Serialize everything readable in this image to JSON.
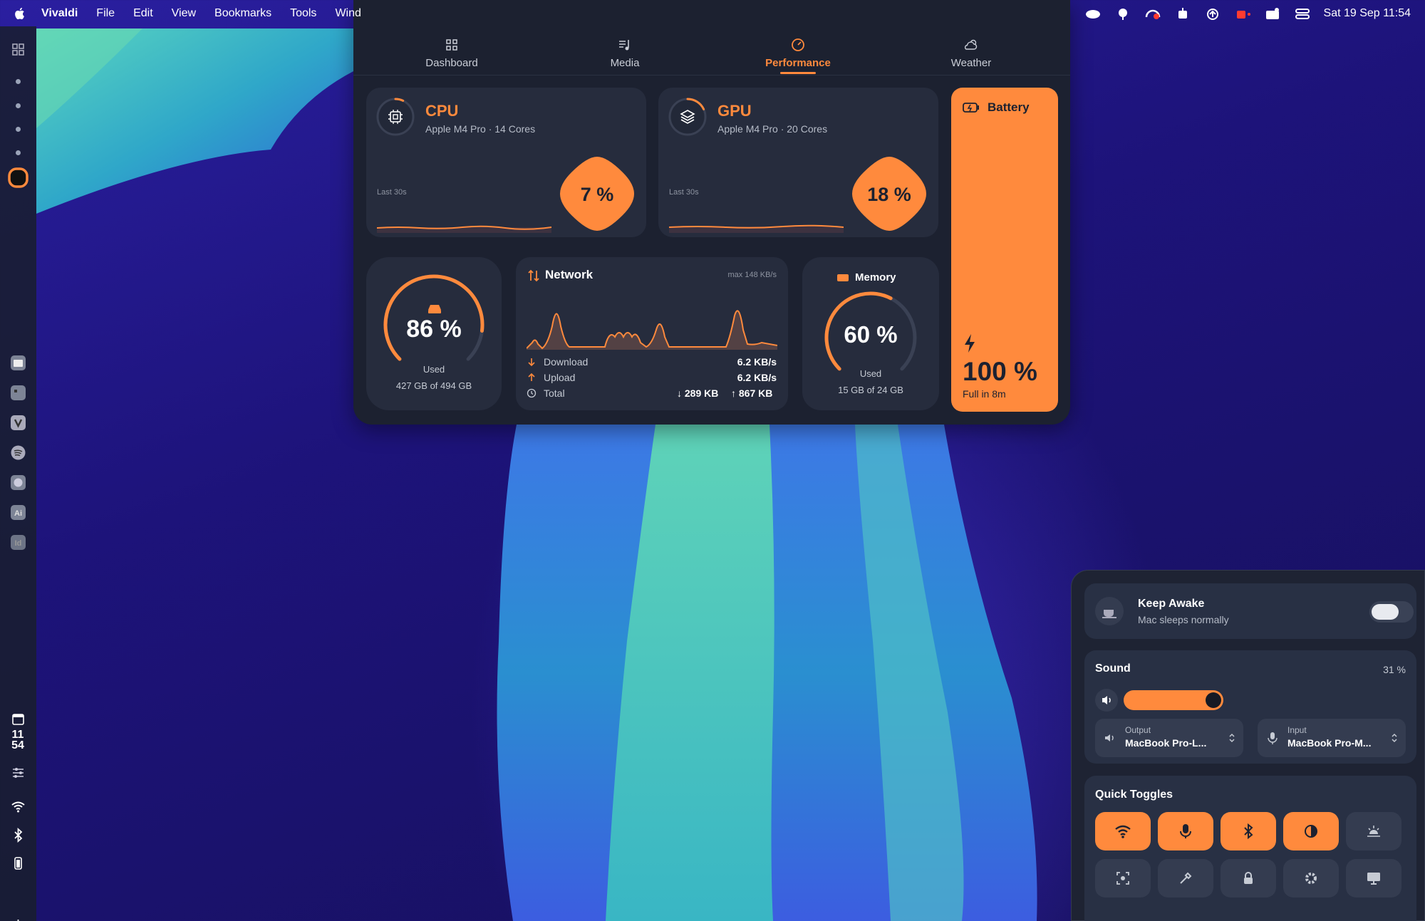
{
  "menubar": {
    "app_name": "Vivaldi",
    "menus": [
      "File",
      "Edit",
      "View",
      "Bookmarks",
      "Tools",
      "Wind"
    ],
    "clock": "Sat 19 Sep  11:54"
  },
  "sidebar": {
    "clock_hour": "11",
    "clock_min": "54"
  },
  "tabs": [
    {
      "label": "Dashboard",
      "icon": "grid-icon"
    },
    {
      "label": "Media",
      "icon": "music-icon"
    },
    {
      "label": "Performance",
      "icon": "gauge-icon",
      "active": true
    },
    {
      "label": "Weather",
      "icon": "cloud-sun-icon"
    }
  ],
  "cpu": {
    "title": "CPU",
    "subtitle": "Apple M4 Pro · 14 Cores",
    "history_label": "Last 30s",
    "percent": "7 %",
    "usage": 0.07
  },
  "gpu": {
    "title": "GPU",
    "subtitle": "Apple M4 Pro · 20 Cores",
    "history_label": "Last 30s",
    "percent": "18 %",
    "usage": 0.18
  },
  "battery": {
    "title": "Battery",
    "percent": "100 %",
    "status": "Full in 8m",
    "level": 1.0
  },
  "disk": {
    "percent": "86 %",
    "label": "Used",
    "detail": "427 GB of 494 GB",
    "usage": 0.86
  },
  "network": {
    "title": "Network",
    "max": "max 148 KB/s",
    "download_label": "Download",
    "download_value": "6.2 KB/s",
    "upload_label": "Upload",
    "upload_value": "6.2 KB/s",
    "total_label": "Total",
    "total_down": "↓ 289 KB",
    "total_up": "↑ 867 KB"
  },
  "memory": {
    "title": "Memory",
    "percent": "60 %",
    "label": "Used",
    "detail": "15 GB of 24 GB",
    "usage": 0.6
  },
  "control_center": {
    "keep_awake": {
      "title": "Keep Awake",
      "subtitle": "Mac sleeps normally",
      "enabled": false
    },
    "sound": {
      "title": "Sound",
      "percent": "31 %",
      "level": 0.31
    },
    "output": {
      "label": "Output",
      "value": "MacBook Pro-L..."
    },
    "input": {
      "label": "Input",
      "value": "MacBook Pro-M..."
    },
    "quick_toggles": {
      "title": "Quick Toggles",
      "row1": [
        {
          "icon": "wifi-icon",
          "on": true
        },
        {
          "icon": "microphone-icon",
          "on": true
        },
        {
          "icon": "bluetooth-icon",
          "on": true
        },
        {
          "icon": "contrast-icon",
          "on": true
        },
        {
          "icon": "sunrise-icon",
          "on": false
        }
      ],
      "row2": [
        {
          "icon": "screenshot-icon",
          "on": false
        },
        {
          "icon": "color-picker-icon",
          "on": false
        },
        {
          "icon": "lock-icon",
          "on": false
        },
        {
          "icon": "gear-icon",
          "on": false
        },
        {
          "icon": "display-icon",
          "on": false
        }
      ]
    }
  },
  "colors": {
    "accent": "#ff8a3d",
    "panel": "#1c2130",
    "card": "#262c3d"
  }
}
